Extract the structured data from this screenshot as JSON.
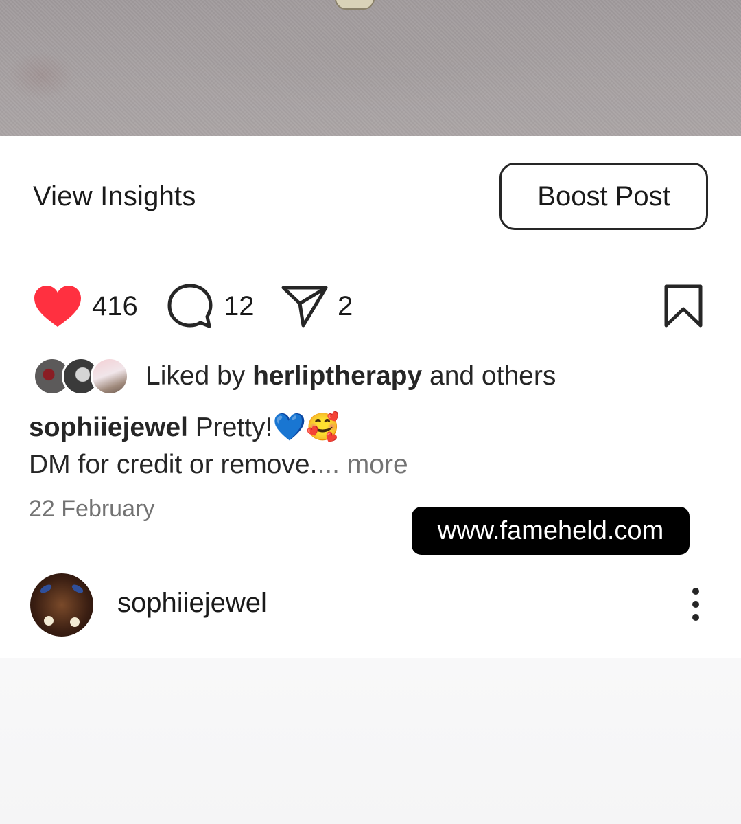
{
  "post_image": {
    "alt": "post-photo"
  },
  "insights": {
    "view_insights_label": "View Insights",
    "boost_label": "Boost Post"
  },
  "actions": {
    "likes": "416",
    "comments": "12",
    "shares": "2",
    "like_color": "#ff3040"
  },
  "liked_by": {
    "prefix": "Liked by ",
    "user": "herliptherapy",
    "suffix": " and others"
  },
  "caption": {
    "user": "sophiiejewel",
    "text_line1": " Pretty!💙🥰",
    "text_line2": "DM for credit or remove.",
    "more": "... more"
  },
  "date": "22 February",
  "watermark": "www.fameheld.com",
  "next_post": {
    "username": "sophiiejewel"
  }
}
